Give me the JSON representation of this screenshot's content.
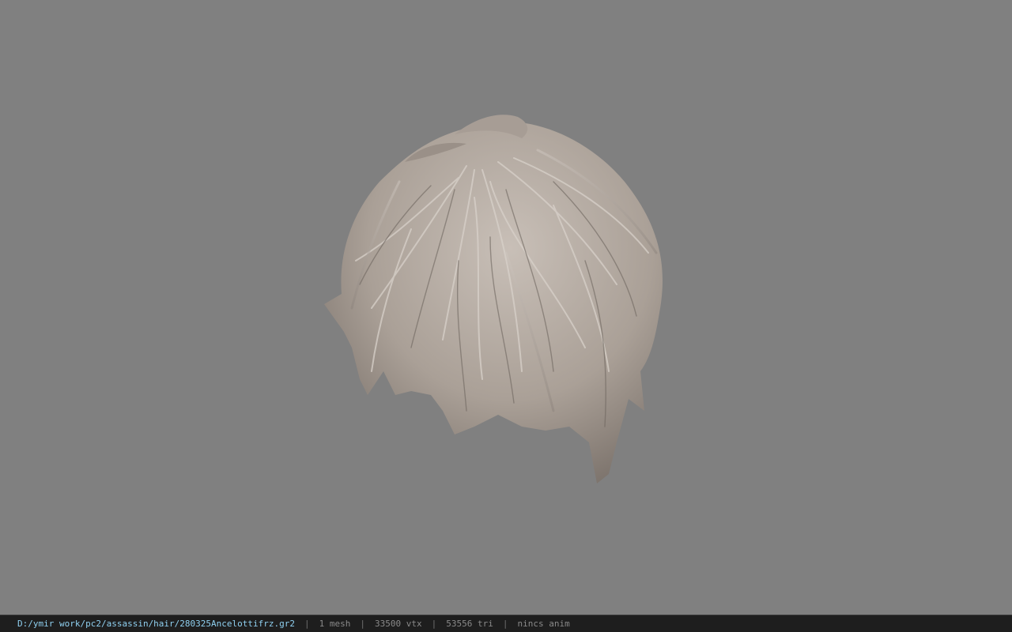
{
  "viewer": {
    "background_color": "#808080",
    "model_object": "hair-mesh",
    "hair_color": "#b4aaa2"
  },
  "statusbar": {
    "file_path": "D:/ymir work/pc2/assassin/hair/280325Ancelottifrz.gr2",
    "separator": "|",
    "mesh_count": "1 mesh",
    "vertex_count": "33500 vtx",
    "triangle_count": "53556 tri",
    "anim_status": "nincs anim"
  }
}
